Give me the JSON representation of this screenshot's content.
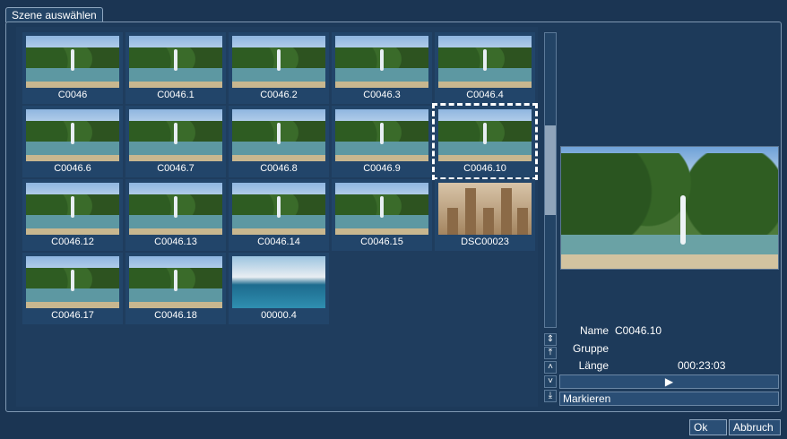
{
  "window": {
    "title": "Szene auswählen"
  },
  "scenes": [
    {
      "label": "C0046",
      "kind": "fountain"
    },
    {
      "label": "C0046.1",
      "kind": "fountain"
    },
    {
      "label": "C0046.2",
      "kind": "fountain"
    },
    {
      "label": "C0046.3",
      "kind": "fountain"
    },
    {
      "label": "C0046.4",
      "kind": "fountain"
    },
    {
      "label": "C0046.6",
      "kind": "fountain"
    },
    {
      "label": "C0046.7",
      "kind": "fountain"
    },
    {
      "label": "C0046.8",
      "kind": "fountain"
    },
    {
      "label": "C0046.9",
      "kind": "fountain"
    },
    {
      "label": "C0046.10",
      "kind": "fountain",
      "selected": true
    },
    {
      "label": "C0046.12",
      "kind": "fountain"
    },
    {
      "label": "C0046.13",
      "kind": "fountain"
    },
    {
      "label": "C0046.14",
      "kind": "fountain"
    },
    {
      "label": "C0046.15",
      "kind": "fountain"
    },
    {
      "label": "DSC00023",
      "kind": "church"
    },
    {
      "label": "C0046.17",
      "kind": "fountain"
    },
    {
      "label": "C0046.18",
      "kind": "fountain"
    },
    {
      "label": "00000.4",
      "kind": "pool"
    }
  ],
  "info": {
    "name_label": "Name",
    "name_value": "C0046.10",
    "group_label": "Gruppe",
    "group_value": "",
    "length_label": "Länge",
    "length_value": "000:23:03"
  },
  "play_button": "▶",
  "mark_button": "Markieren",
  "footer": {
    "ok": "Ok",
    "cancel": "Abbruch"
  },
  "icons": {
    "scroll_updown": "updown-arrows-icon",
    "scroll_top": "scroll-top-icon",
    "scroll_up": "scroll-up-icon",
    "scroll_down": "scroll-down-icon",
    "scroll_bottom": "scroll-bottom-icon"
  }
}
